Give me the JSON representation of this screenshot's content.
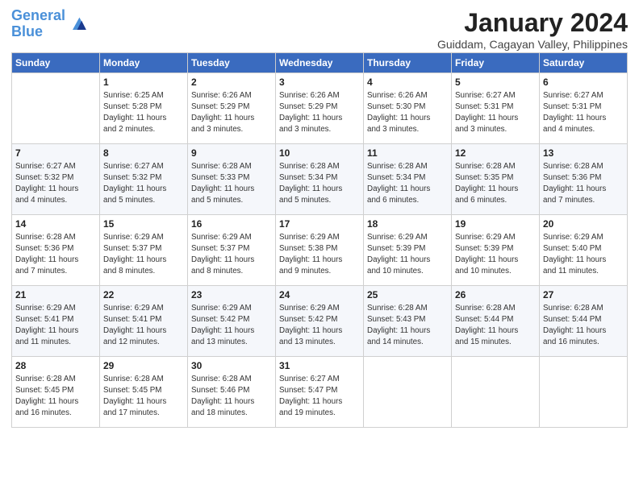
{
  "header": {
    "logo_line1": "General",
    "logo_line2": "Blue",
    "month_title": "January 2024",
    "subtitle": "Guiddam, Cagayan Valley, Philippines"
  },
  "days_of_week": [
    "Sunday",
    "Monday",
    "Tuesday",
    "Wednesday",
    "Thursday",
    "Friday",
    "Saturday"
  ],
  "weeks": [
    [
      {
        "day": "",
        "info": ""
      },
      {
        "day": "1",
        "info": "Sunrise: 6:25 AM\nSunset: 5:28 PM\nDaylight: 11 hours\nand 2 minutes."
      },
      {
        "day": "2",
        "info": "Sunrise: 6:26 AM\nSunset: 5:29 PM\nDaylight: 11 hours\nand 3 minutes."
      },
      {
        "day": "3",
        "info": "Sunrise: 6:26 AM\nSunset: 5:29 PM\nDaylight: 11 hours\nand 3 minutes."
      },
      {
        "day": "4",
        "info": "Sunrise: 6:26 AM\nSunset: 5:30 PM\nDaylight: 11 hours\nand 3 minutes."
      },
      {
        "day": "5",
        "info": "Sunrise: 6:27 AM\nSunset: 5:31 PM\nDaylight: 11 hours\nand 3 minutes."
      },
      {
        "day": "6",
        "info": "Sunrise: 6:27 AM\nSunset: 5:31 PM\nDaylight: 11 hours\nand 4 minutes."
      }
    ],
    [
      {
        "day": "7",
        "info": "Sunrise: 6:27 AM\nSunset: 5:32 PM\nDaylight: 11 hours\nand 4 minutes."
      },
      {
        "day": "8",
        "info": "Sunrise: 6:27 AM\nSunset: 5:32 PM\nDaylight: 11 hours\nand 5 minutes."
      },
      {
        "day": "9",
        "info": "Sunrise: 6:28 AM\nSunset: 5:33 PM\nDaylight: 11 hours\nand 5 minutes."
      },
      {
        "day": "10",
        "info": "Sunrise: 6:28 AM\nSunset: 5:34 PM\nDaylight: 11 hours\nand 5 minutes."
      },
      {
        "day": "11",
        "info": "Sunrise: 6:28 AM\nSunset: 5:34 PM\nDaylight: 11 hours\nand 6 minutes."
      },
      {
        "day": "12",
        "info": "Sunrise: 6:28 AM\nSunset: 5:35 PM\nDaylight: 11 hours\nand 6 minutes."
      },
      {
        "day": "13",
        "info": "Sunrise: 6:28 AM\nSunset: 5:36 PM\nDaylight: 11 hours\nand 7 minutes."
      }
    ],
    [
      {
        "day": "14",
        "info": "Sunrise: 6:28 AM\nSunset: 5:36 PM\nDaylight: 11 hours\nand 7 minutes."
      },
      {
        "day": "15",
        "info": "Sunrise: 6:29 AM\nSunset: 5:37 PM\nDaylight: 11 hours\nand 8 minutes."
      },
      {
        "day": "16",
        "info": "Sunrise: 6:29 AM\nSunset: 5:37 PM\nDaylight: 11 hours\nand 8 minutes."
      },
      {
        "day": "17",
        "info": "Sunrise: 6:29 AM\nSunset: 5:38 PM\nDaylight: 11 hours\nand 9 minutes."
      },
      {
        "day": "18",
        "info": "Sunrise: 6:29 AM\nSunset: 5:39 PM\nDaylight: 11 hours\nand 10 minutes."
      },
      {
        "day": "19",
        "info": "Sunrise: 6:29 AM\nSunset: 5:39 PM\nDaylight: 11 hours\nand 10 minutes."
      },
      {
        "day": "20",
        "info": "Sunrise: 6:29 AM\nSunset: 5:40 PM\nDaylight: 11 hours\nand 11 minutes."
      }
    ],
    [
      {
        "day": "21",
        "info": "Sunrise: 6:29 AM\nSunset: 5:41 PM\nDaylight: 11 hours\nand 11 minutes."
      },
      {
        "day": "22",
        "info": "Sunrise: 6:29 AM\nSunset: 5:41 PM\nDaylight: 11 hours\nand 12 minutes."
      },
      {
        "day": "23",
        "info": "Sunrise: 6:29 AM\nSunset: 5:42 PM\nDaylight: 11 hours\nand 13 minutes."
      },
      {
        "day": "24",
        "info": "Sunrise: 6:29 AM\nSunset: 5:42 PM\nDaylight: 11 hours\nand 13 minutes."
      },
      {
        "day": "25",
        "info": "Sunrise: 6:28 AM\nSunset: 5:43 PM\nDaylight: 11 hours\nand 14 minutes."
      },
      {
        "day": "26",
        "info": "Sunrise: 6:28 AM\nSunset: 5:44 PM\nDaylight: 11 hours\nand 15 minutes."
      },
      {
        "day": "27",
        "info": "Sunrise: 6:28 AM\nSunset: 5:44 PM\nDaylight: 11 hours\nand 16 minutes."
      }
    ],
    [
      {
        "day": "28",
        "info": "Sunrise: 6:28 AM\nSunset: 5:45 PM\nDaylight: 11 hours\nand 16 minutes."
      },
      {
        "day": "29",
        "info": "Sunrise: 6:28 AM\nSunset: 5:45 PM\nDaylight: 11 hours\nand 17 minutes."
      },
      {
        "day": "30",
        "info": "Sunrise: 6:28 AM\nSunset: 5:46 PM\nDaylight: 11 hours\nand 18 minutes."
      },
      {
        "day": "31",
        "info": "Sunrise: 6:27 AM\nSunset: 5:47 PM\nDaylight: 11 hours\nand 19 minutes."
      },
      {
        "day": "",
        "info": ""
      },
      {
        "day": "",
        "info": ""
      },
      {
        "day": "",
        "info": ""
      }
    ]
  ]
}
